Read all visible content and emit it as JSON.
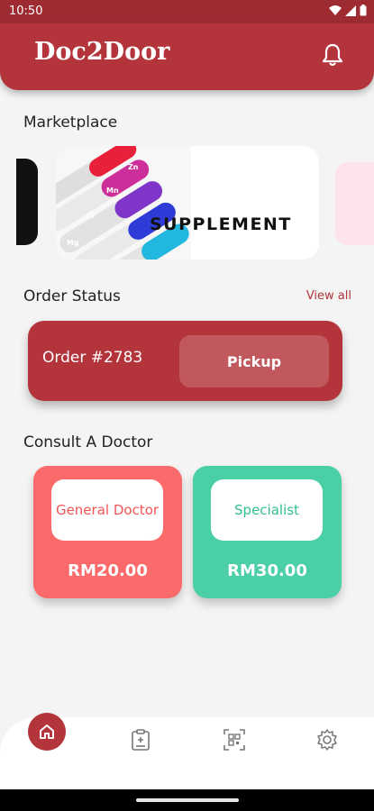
{
  "status_bar": {
    "time": "10:50"
  },
  "app_bar": {
    "title": "Doc2Door"
  },
  "marketplace": {
    "title": "Marketplace",
    "banner_text": "SUPPLEMENT",
    "capsule_labels": [
      "Zn",
      "Mn",
      "Cr",
      "Mg"
    ]
  },
  "order_status": {
    "title": "Order Status",
    "view_all": "View all",
    "order_id": "Order #2783",
    "action": "Pickup"
  },
  "consult": {
    "title": "Consult A Doctor",
    "cards": [
      {
        "label": "General Doctor",
        "price": "RM20.00"
      },
      {
        "label": "Specialist",
        "price": "RM30.00"
      }
    ]
  },
  "bottom_nav": {
    "items": [
      "home-icon",
      "clipboard-icon",
      "qr-scan-icon",
      "gear-icon"
    ]
  },
  "colors": {
    "primary": "#b3343b",
    "general": "#fb6a6a",
    "specialist": "#4bcfa7"
  }
}
